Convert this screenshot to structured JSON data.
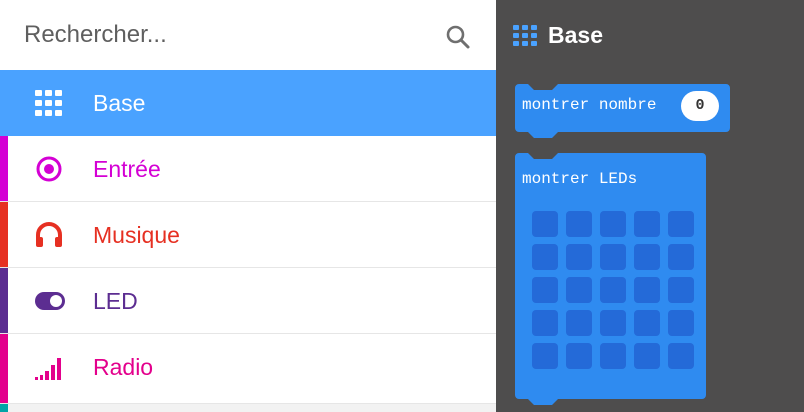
{
  "search": {
    "placeholder": "Rechercher..."
  },
  "toolbox": {
    "categories": [
      {
        "label": "Base",
        "color": "#1e90ff",
        "icon": "grid-icon"
      },
      {
        "label": "Entrée",
        "color": "#d400d4",
        "icon": "target-icon"
      },
      {
        "label": "Musique",
        "color": "#e63022",
        "icon": "headphones-icon"
      },
      {
        "label": "LED",
        "color": "#5c2d91",
        "icon": "toggle-icon"
      },
      {
        "label": "Radio",
        "color": "#e3008c",
        "icon": "signal-bars-icon"
      }
    ]
  },
  "flyout": {
    "title": "Base",
    "blocks": [
      {
        "label": "montrer nombre",
        "value": "0"
      },
      {
        "label": "montrer LEDs"
      }
    ]
  },
  "colors": {
    "selected_bg": "#4aa2ff",
    "block": "#2f8bf0",
    "led_off": "#246ad8",
    "flyout_bg": "#4e4d4d"
  }
}
